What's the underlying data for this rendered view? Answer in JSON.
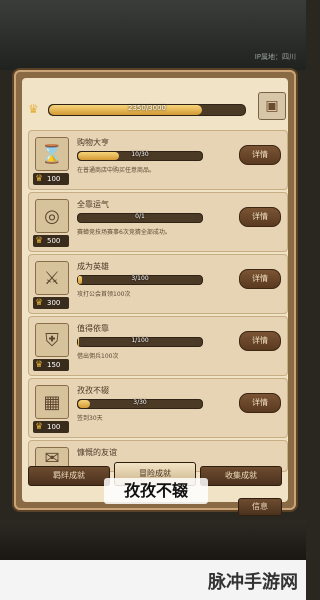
{
  "header": {
    "region": "IP属地：四川"
  },
  "total_progress": {
    "text": "2350/3000",
    "fraction": 0.783
  },
  "cards": [
    {
      "title": "购物大亨",
      "progress_text": "10/30",
      "fraction": 0.33,
      "desc": "在普通商店中购买任意商品。",
      "reward": "100",
      "icon": "hourglass-icon",
      "button": "详情"
    },
    {
      "title": "全靠运气",
      "progress_text": "0/1",
      "fraction": 0.0,
      "desc": "赛蟑竞技场赛事6次竞猜全部成功。",
      "reward": "500",
      "icon": "coins-icon",
      "button": "详情"
    },
    {
      "title": "成为英雄",
      "progress_text": "3/100",
      "fraction": 0.03,
      "desc": "攻打公会首领100次",
      "reward": "300",
      "icon": "hero-icon",
      "button": "详情"
    },
    {
      "title": "值得依靠",
      "progress_text": "1/100",
      "fraction": 0.01,
      "desc": "借出佣兵100次",
      "reward": "150",
      "icon": "shield-icon",
      "button": "详情"
    },
    {
      "title": "孜孜不辍",
      "progress_text": "3/30",
      "fraction": 0.1,
      "desc": "签到30天",
      "reward": "100",
      "icon": "calendar-icon",
      "button": "详情"
    },
    {
      "title": "慷慨的友谊",
      "progress_text": "",
      "fraction": 0,
      "desc": "",
      "reward": "",
      "icon": "gift-icon",
      "button": ""
    }
  ],
  "tabs": [
    {
      "label": "羁绊成就"
    },
    {
      "label": "冒险成就"
    },
    {
      "label": "收集成就"
    }
  ],
  "caption": "孜孜不辍",
  "info_button": "信息",
  "watermark": "脉冲手游网"
}
